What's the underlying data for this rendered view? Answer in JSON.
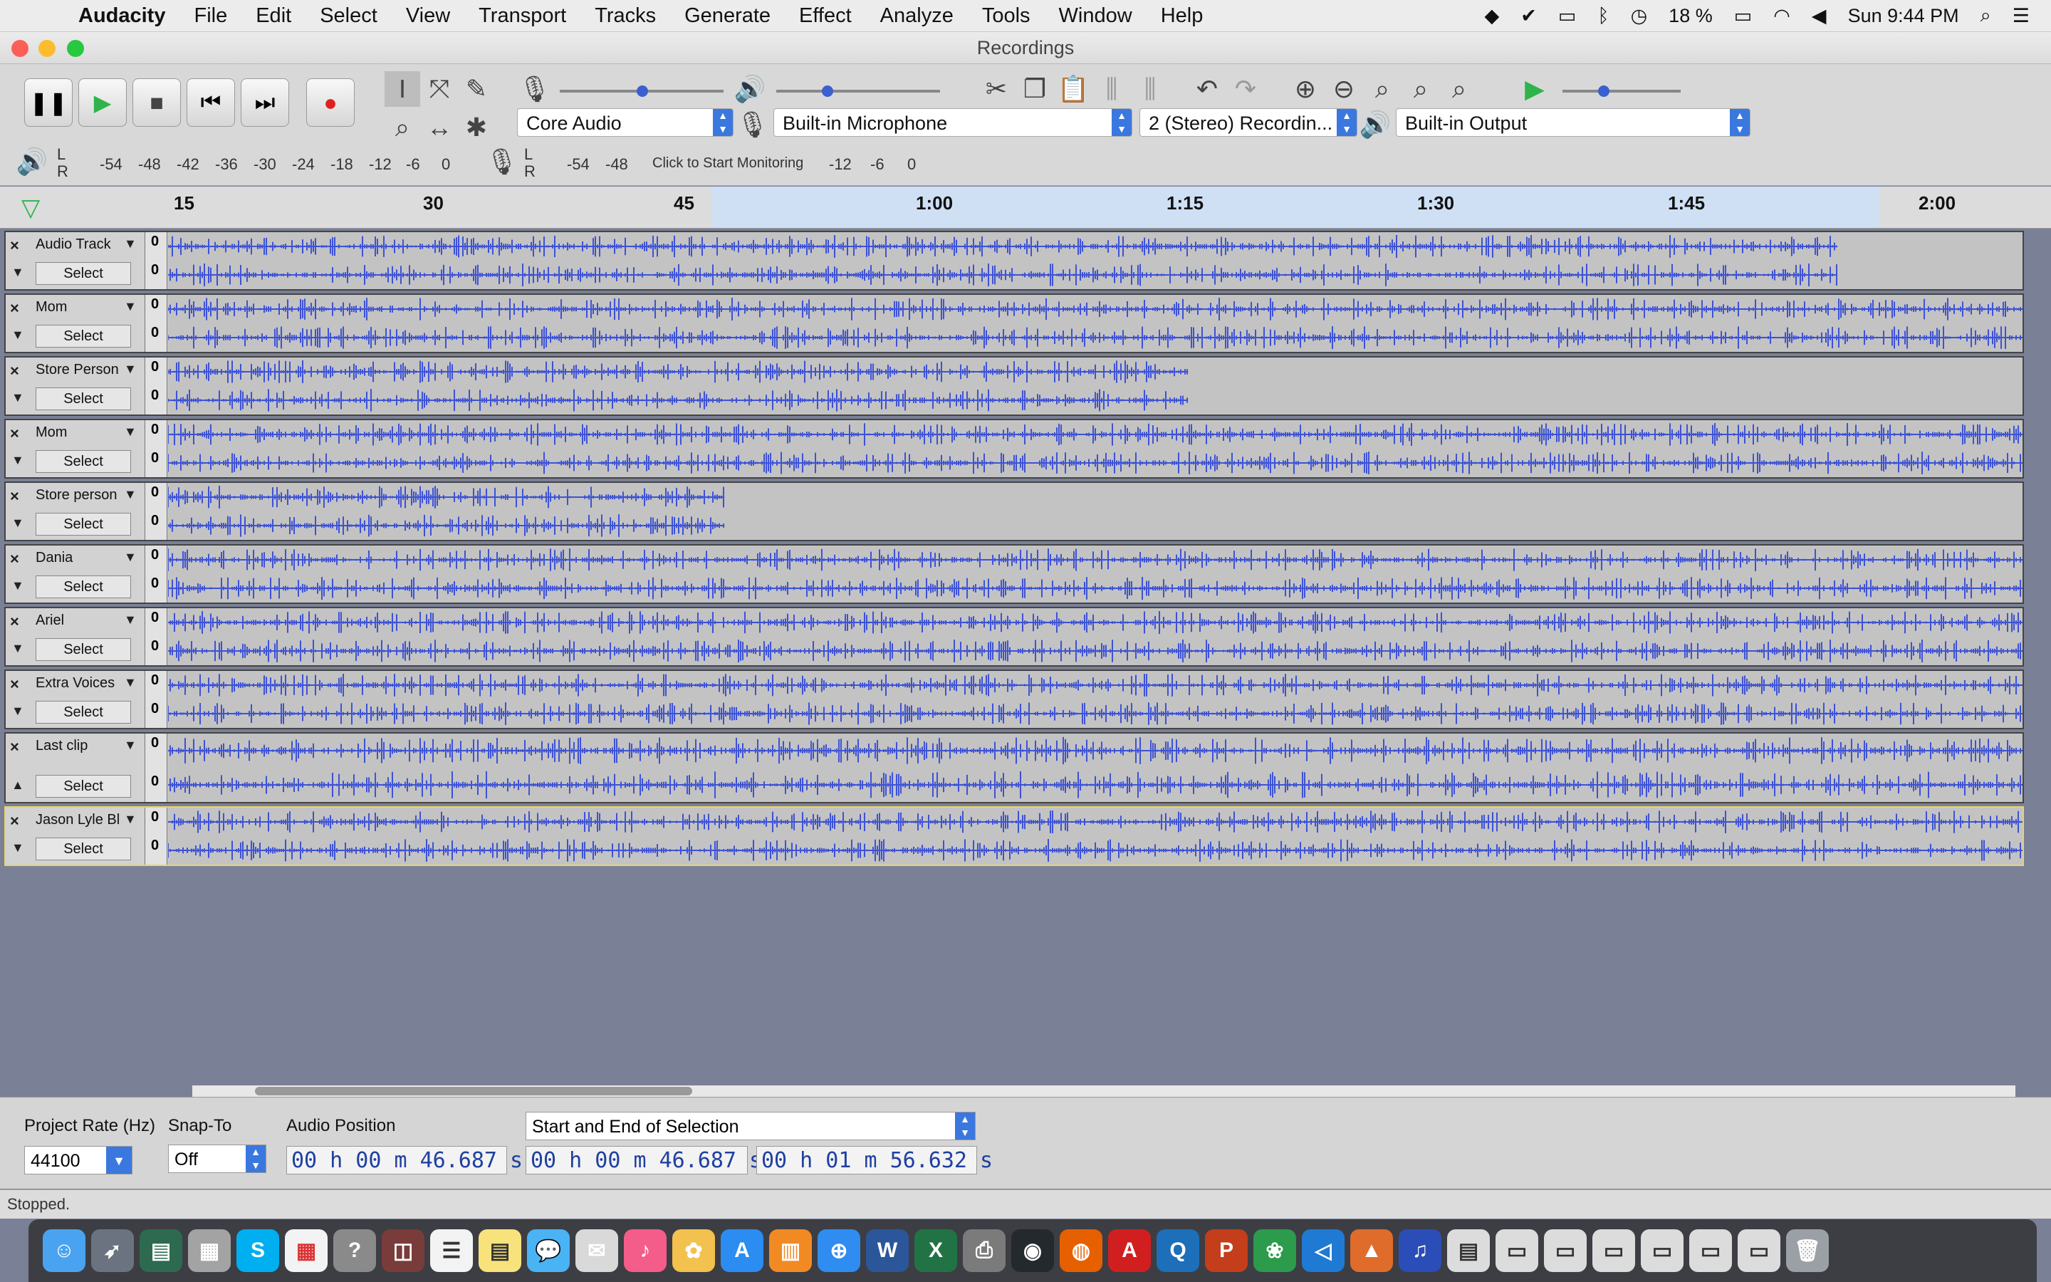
{
  "menubar": {
    "app_name": "Audacity",
    "items": [
      "File",
      "Edit",
      "Select",
      "View",
      "Transport",
      "Tracks",
      "Generate",
      "Effect",
      "Analyze",
      "Tools",
      "Window",
      "Help"
    ],
    "battery": "18 %",
    "clock": "Sun 9:44 PM"
  },
  "window": {
    "title": "Recordings"
  },
  "devices": {
    "host": "Core Audio",
    "input": "Built-in Microphone",
    "channels": "2 (Stereo) Recordin...",
    "output": "Built-in Output"
  },
  "meters": {
    "playback_scale": [
      "-54",
      "-48",
      "-42",
      "-36",
      "-30",
      "-24",
      "-18",
      "-12",
      "-6",
      "0"
    ],
    "record_scale": [
      "-54",
      "-48",
      "-12",
      "-6",
      "0"
    ],
    "monitor_label": "Click to Start Monitoring",
    "lr": [
      "L",
      "R"
    ]
  },
  "ruler": {
    "labels": [
      "15",
      "30",
      "45",
      "1:00",
      "1:15",
      "1:30",
      "1:45",
      "2:00"
    ]
  },
  "tracks": [
    {
      "name": "Audio Track",
      "select_label": "Select",
      "zero": "0",
      "end": 0.9
    },
    {
      "name": "Mom",
      "select_label": "Select",
      "zero": "0",
      "end": 1.0
    },
    {
      "name": "Store Person",
      "select_label": "Select",
      "zero": "0",
      "end": 0.55
    },
    {
      "name": "Mom",
      "select_label": "Select",
      "zero": "0",
      "end": 1.0
    },
    {
      "name": "Store person",
      "select_label": "Select",
      "zero": "0",
      "end": 0.3
    },
    {
      "name": "Dania",
      "select_label": "Select",
      "zero": "0",
      "end": 1.0
    },
    {
      "name": "Ariel",
      "select_label": "Select",
      "zero": "0",
      "end": 1.0
    },
    {
      "name": "Extra Voices",
      "select_label": "Select",
      "zero": "0",
      "end": 1.0
    },
    {
      "name": "Last clip",
      "select_label": "Select",
      "zero": "0",
      "end": 1.0
    },
    {
      "name": "Jason Lyle Bl",
      "select_label": "Select",
      "zero": "0",
      "end": 1.0
    }
  ],
  "selection_toolbar": {
    "project_rate_label": "Project Rate (Hz)",
    "project_rate_value": "44100",
    "snap_to_label": "Snap-To",
    "snap_to_value": "Off",
    "audio_position_label": "Audio Position",
    "audio_position": "00 h 00 m 46.687 s",
    "selection_mode": "Start and End of Selection",
    "selection_start": "00 h 00 m 46.687 s",
    "selection_end": "00 h 01 m 56.632 s"
  },
  "status": {
    "text": "Stopped."
  },
  "colors": {
    "waveform": "#3d52d5",
    "selection": "#cfe0f5",
    "selected_track_border": "#e8d36a"
  }
}
